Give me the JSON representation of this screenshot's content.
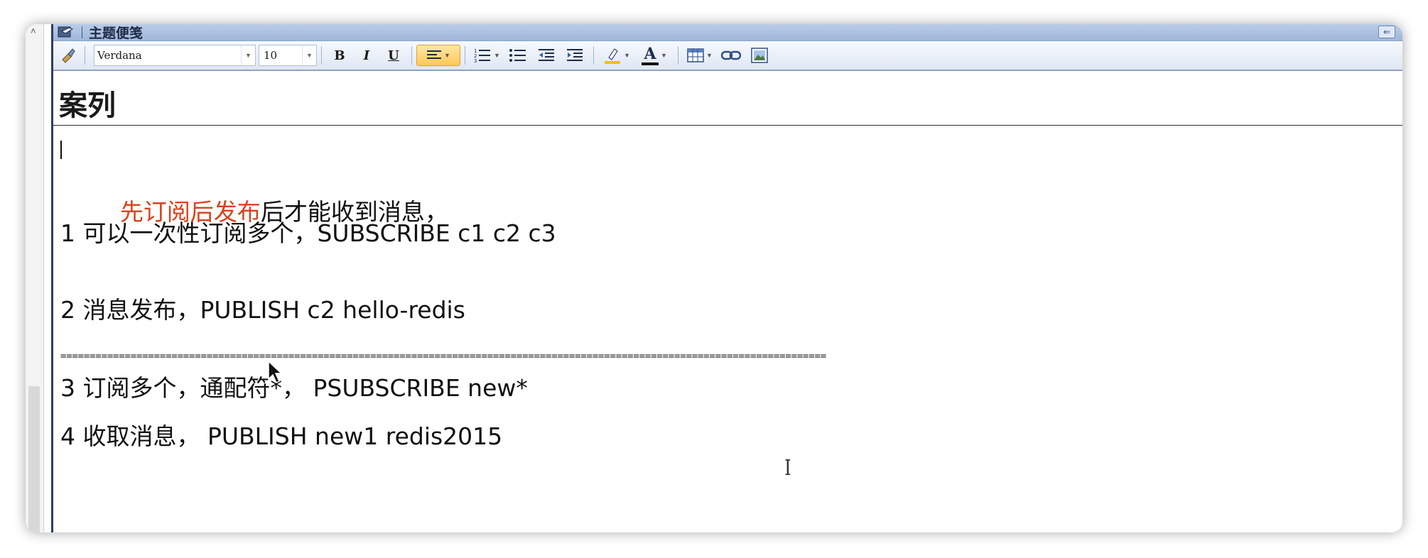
{
  "window": {
    "title": "主题便笺"
  },
  "toolbar": {
    "font_family": "Verdana",
    "font_size": "10",
    "bold_label": "B",
    "italic_label": "I",
    "underline_label": "U",
    "highlight_color": "#f2c200",
    "text_color_label": "A",
    "font_color": "#111111"
  },
  "content": {
    "heading": "案列",
    "lines": {
      "l1_red": "先订阅后发布",
      "l1_rest": "后才能收到消息，",
      "l2": "1 可以一次性订阅多个，SUBSCRIBE c1 c2 c3",
      "l3": "2 消息发布，PUBLISH c2 hello-redis",
      "separator": "===================================================================================================================================",
      "l4": "3 订阅多个，通配符*， PSUBSCRIBE new*",
      "l5": "4 收取消息， PUBLISH new1 redis2015"
    }
  },
  "colors": {
    "accent_red": "#d6431c",
    "titlebar": "#b9cde8",
    "active_button": "#ffc857"
  },
  "icons": [
    "note-icon",
    "collapse-icon",
    "clear-format-icon",
    "bold-icon",
    "italic-icon",
    "underline-icon",
    "align-left-icon",
    "numbered-list-icon",
    "bullet-list-icon",
    "outdent-icon",
    "indent-icon",
    "highlight-icon",
    "font-color-icon",
    "table-icon",
    "link-icon",
    "image-icon",
    "text-cursor-icon",
    "mouse-pointer-icon"
  ]
}
